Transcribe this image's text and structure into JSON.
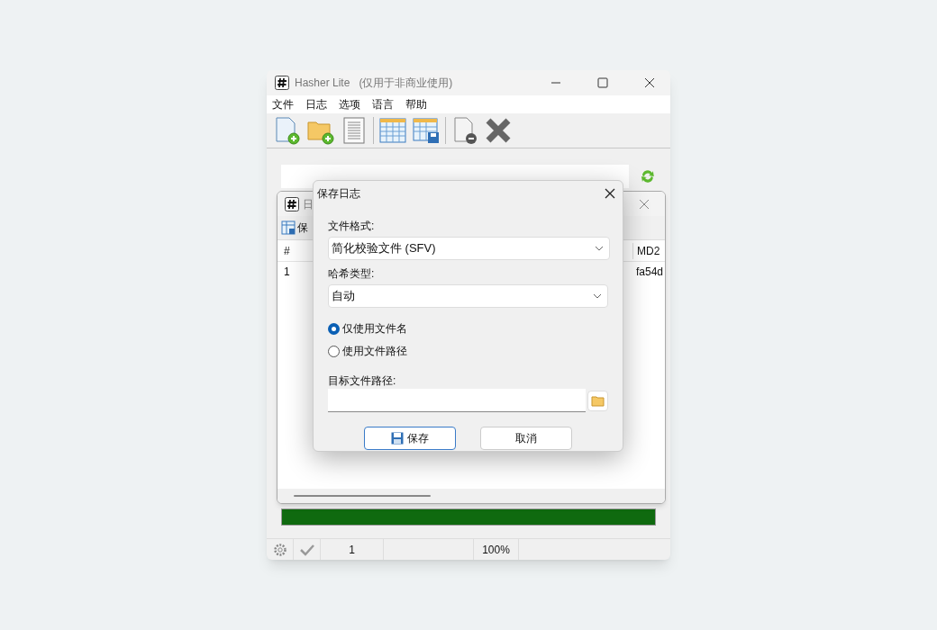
{
  "main_window": {
    "title": "Hasher Lite",
    "subtitle": "(仅用于非商业使用)",
    "menu": [
      "文件",
      "日志",
      "选项",
      "语言",
      "帮助"
    ],
    "progress": {
      "level": 1
    },
    "status_bar": {
      "count": "1",
      "percent": "100%"
    }
  },
  "log_window": {
    "title": "日",
    "toolbar_label": "保",
    "columns": [
      "#",
      "MD2"
    ],
    "rows": [
      [
        "1",
        "fa54d"
      ]
    ]
  },
  "dialog": {
    "title": "保存日志",
    "format_label": "文件格式:",
    "format_value": "简化校验文件 (SFV)",
    "hash_label": "哈希类型:",
    "hash_value": "自动",
    "radios": [
      {
        "label": "仅使用文件名",
        "selected": true
      },
      {
        "label": "使用文件路径",
        "selected": false
      }
    ],
    "target_label": "目标文件路径:",
    "buttons": [
      {
        "label": "保存",
        "kind": "primary"
      },
      {
        "label": "取消",
        "kind": "secondary"
      }
    ]
  }
}
